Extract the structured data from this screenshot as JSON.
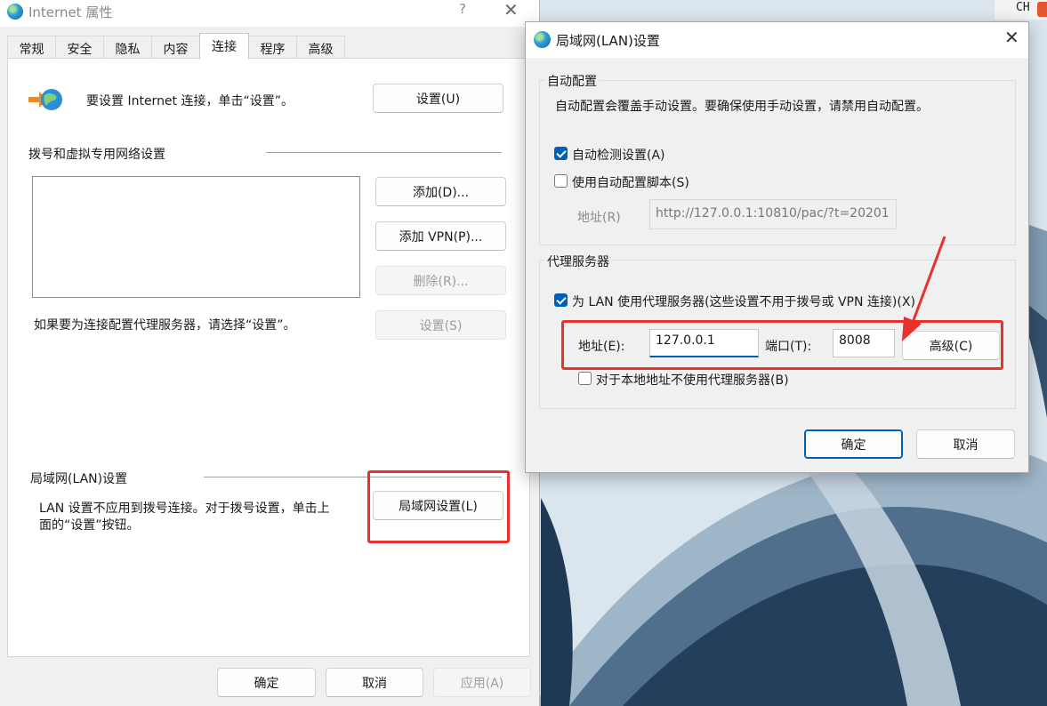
{
  "tray": {
    "ime_label": "CH"
  },
  "colors": {
    "accent": "#005fb8",
    "annotation_red": "#e8312d",
    "dialog_bg": "#f0f0f0"
  },
  "internet_properties": {
    "title": "Internet 属性",
    "help_glyph": "?",
    "close_glyph": "✕",
    "tabs": [
      {
        "label": "常规"
      },
      {
        "label": "安全"
      },
      {
        "label": "隐私"
      },
      {
        "label": "内容"
      },
      {
        "label": "连接",
        "active": true
      },
      {
        "label": "程序"
      },
      {
        "label": "高级"
      }
    ],
    "setup_text": "要设置 Internet 连接，单击“设置”。",
    "setup_button": "设置(U)",
    "dialup_section_title": "拨号和虚拟专用网络设置",
    "add_button": "添加(D)...",
    "add_vpn_button": "添加 VPN(P)...",
    "remove_button": "删除(R)...",
    "proxy_hint": "如果要为连接配置代理服务器，请选择“设置”。",
    "settings_button": "设置(S)",
    "lan_section_title": "局域网(LAN)设置",
    "lan_text_line1": "LAN 设置不应用到拨号连接。对于拨号设置，单击上",
    "lan_text_line2": "面的“设置”按钮。",
    "lan_settings_button": "局域网设置(L)",
    "ok_button": "确定",
    "cancel_button": "取消",
    "apply_button": "应用(A)"
  },
  "lan_dialog": {
    "title": "局域网(LAN)设置",
    "close_glyph": "✕",
    "auto_config_title": "自动配置",
    "auto_config_desc": "自动配置会覆盖手动设置。要确保使用手动设置，请禁用自动配置。",
    "auto_detect_label": "自动检测设置(A)",
    "auto_detect_checked": true,
    "auto_script_label": "使用自动配置脚本(S)",
    "auto_script_checked": false,
    "script_address_label": "地址(R)",
    "script_address_value": "http://127.0.0.1:10810/pac/?t=20201",
    "proxy_title": "代理服务器",
    "use_proxy_label": "为 LAN 使用代理服务器(这些设置不用于拨号或 VPN 连接)(X)",
    "use_proxy_checked": true,
    "address_label": "地址(E):",
    "address_value": "127.0.0.1",
    "port_label": "端口(T):",
    "port_value": "8008",
    "advanced_button": "高级(C)",
    "bypass_local_label": "对于本地地址不使用代理服务器(B)",
    "bypass_local_checked": false,
    "ok_button": "确定",
    "cancel_button": "取消"
  }
}
